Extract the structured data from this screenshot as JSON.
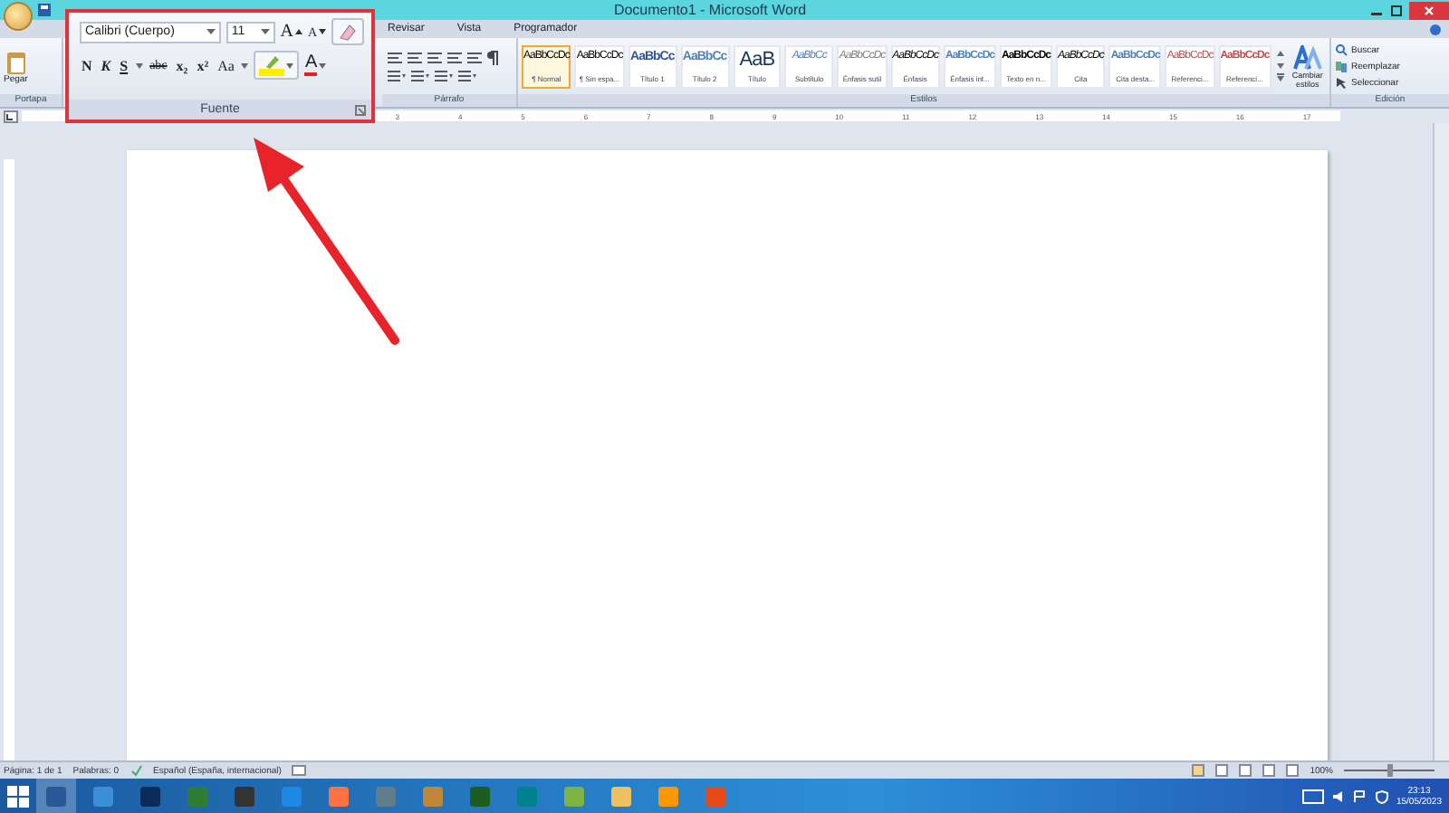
{
  "window": {
    "title": "Documento1 - Microsoft Word"
  },
  "ribbon_tabs": [
    {
      "label": "Revisar",
      "selected": false
    },
    {
      "label": "Vista",
      "selected": false
    },
    {
      "label": "Programador",
      "selected": false
    }
  ],
  "clipboard": {
    "paste_label": "Pegar",
    "group_label": "Portapa"
  },
  "font_group": {
    "font": "Calibri (Cuerpo)",
    "size": "11",
    "grow": "A",
    "shrink": "A",
    "buttons": [
      {
        "label": "N",
        "kind": "bold"
      },
      {
        "label": "K",
        "kind": "italic"
      },
      {
        "label": "S",
        "kind": "underline"
      },
      {
        "label": "abc",
        "kind": "strike"
      },
      {
        "label": "x₂",
        "kind": "sub"
      },
      {
        "label": "x²",
        "kind": "sup"
      },
      {
        "label": "Aa",
        "kind": "case"
      }
    ],
    "font_color_label": "A",
    "group_label": "Fuente"
  },
  "paragraph": {
    "group_label": "Párrafo"
  },
  "styles": {
    "group_label": "Estilos",
    "items": [
      {
        "preview": "AaBbCcDc",
        "name": "¶ Normal",
        "selected": true,
        "color": "#000000",
        "kind": "body"
      },
      {
        "preview": "AaBbCcDc",
        "name": "¶ Sin espa...",
        "selected": false,
        "color": "#000000",
        "kind": "body"
      },
      {
        "preview": "AaBbCc",
        "name": "Título 1",
        "selected": false,
        "color": "#2f5597",
        "kind": "heading"
      },
      {
        "preview": "AaBbCc",
        "name": "Título 2",
        "selected": false,
        "color": "#4f81bd",
        "kind": "heading"
      },
      {
        "preview": "AaB",
        "name": "Título",
        "selected": false,
        "color": "#17365d",
        "kind": "title"
      },
      {
        "preview": "AaBbCc",
        "name": "Subtítulo",
        "selected": false,
        "color": "#4f81bd",
        "kind": "italic"
      },
      {
        "preview": "AaBbCcDc",
        "name": "Énfasis sutil",
        "selected": false,
        "color": "#808080",
        "kind": "italic"
      },
      {
        "preview": "AaBbCcDc",
        "name": "Énfasis",
        "selected": false,
        "color": "#000000",
        "kind": "italic"
      },
      {
        "preview": "AaBbCcDc",
        "name": "Énfasis int...",
        "selected": false,
        "color": "#4f81bd",
        "kind": "bold"
      },
      {
        "preview": "AaBbCcDc",
        "name": "Texto en n...",
        "selected": false,
        "color": "#000000",
        "kind": "bold"
      },
      {
        "preview": "AaBbCcDc",
        "name": "Cita",
        "selected": false,
        "color": "#000000",
        "kind": "italic"
      },
      {
        "preview": "AaBbCcDc",
        "name": "Cita desta...",
        "selected": false,
        "color": "#4f81bd",
        "kind": "bold"
      },
      {
        "preview": "AaBbCcDc",
        "name": "Referenci...",
        "selected": false,
        "color": "#c0504d",
        "kind": "body"
      },
      {
        "preview": "AaBbCcDc",
        "name": "Referenci...",
        "selected": false,
        "color": "#c0504d",
        "kind": "bold"
      }
    ],
    "change_styles": "Cambiar estilos"
  },
  "editing": {
    "group_label": "Edición",
    "items": [
      "Buscar",
      "Reemplazar",
      "Seleccionar"
    ]
  },
  "ruler": {
    "numbers": [
      "3",
      "4",
      "5",
      "6",
      "7",
      "8",
      "9",
      "10",
      "11",
      "12",
      "13",
      "14",
      "15",
      "16",
      "17"
    ]
  },
  "status_bar": {
    "items": [
      "Página: 1 de 1",
      "Palabras: 0",
      "Español (España, internacional)"
    ],
    "zoom": "100%",
    "zoom_slider": {
      "level": 0.5
    }
  },
  "taskbar": {
    "time": "23:13",
    "date": "15/05/2023"
  }
}
